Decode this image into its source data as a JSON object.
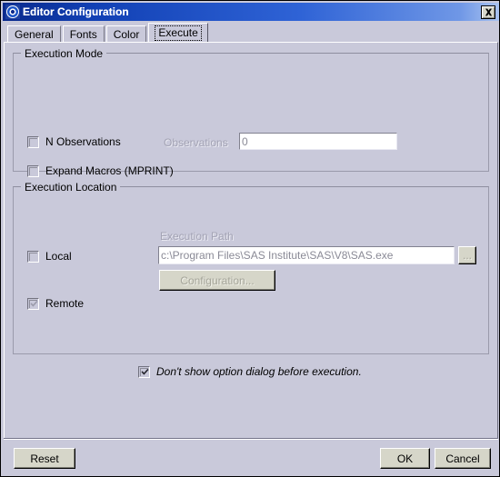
{
  "window": {
    "title": "Editor Configuration",
    "icon": "target-circle-icon",
    "close_label": "✕"
  },
  "tabs": [
    {
      "label": "General",
      "selected": false
    },
    {
      "label": "Fonts",
      "selected": false
    },
    {
      "label": "Color",
      "selected": false
    },
    {
      "label": "Execute",
      "selected": true
    }
  ],
  "execution_mode": {
    "group_title": "Execution Mode",
    "n_observations": {
      "label": "N Observations",
      "checked": false
    },
    "observations": {
      "label": "Observations",
      "value": "0",
      "disabled": true
    },
    "expand_macros": {
      "label": "Expand Macros (MPRINT)",
      "checked": false
    }
  },
  "execution_location": {
    "group_title": "Execution Location",
    "local": {
      "label": "Local",
      "checked": false
    },
    "remote": {
      "label": "Remote",
      "checked": true
    },
    "execution_path": {
      "label": "Execution Path",
      "value": "c:\\Program Files\\SAS Institute\\SAS\\V8\\SAS.exe",
      "disabled": true
    },
    "browse_button": {
      "label": "...",
      "disabled": true
    },
    "configuration_button": {
      "label": "Configuration...",
      "disabled": true
    }
  },
  "dont_show_option": {
    "label": "Don't show option dialog before execution.",
    "checked": true
  },
  "footer": {
    "reset_label": "Reset",
    "ok_label": "OK",
    "cancel_label": "Cancel"
  },
  "colors": {
    "panel": "#c9c9da",
    "title_start": "#0a2a8c",
    "title_end": "#a9c2f0",
    "button_face": "#d6d6c9",
    "disabled_text": "#a3a3b4"
  }
}
